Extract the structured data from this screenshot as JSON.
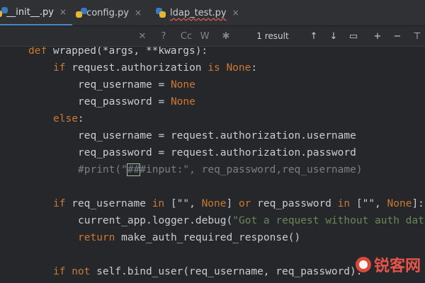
{
  "tabs": [
    {
      "label": "__init__.py",
      "active": true
    },
    {
      "label": "config.py",
      "active": false
    },
    {
      "label": "ldap_test.py",
      "active": false,
      "error": true
    }
  ],
  "tab_close_glyph": "×",
  "findbar": {
    "icons": [
      "close-icon",
      "regex-icon",
      "case-icon",
      "word-icon",
      "filter-icon"
    ],
    "labels": {
      "case": "Cc",
      "word": "W",
      "regex": "?"
    },
    "result_text": "1 result",
    "nav": [
      "up-arrow-icon",
      "down-arrow-icon",
      "select-all-icon",
      "add-selection-icon",
      "remove-selection-icon",
      "filter-icon"
    ]
  },
  "code": {
    "lines": [
      {
        "indent": 0,
        "tokens": [
          {
            "t": "kw",
            "v": "def "
          },
          {
            "t": "plain",
            "v": "wrapped(*args, **kwargs):"
          }
        ]
      },
      {
        "indent": 1,
        "tokens": [
          {
            "t": "kw",
            "v": "if "
          },
          {
            "t": "plain",
            "v": "request.authorization "
          },
          {
            "t": "kw",
            "v": "is None"
          },
          {
            "t": "plain",
            "v": ":"
          }
        ]
      },
      {
        "indent": 2,
        "tokens": [
          {
            "t": "plain",
            "v": "req_username = "
          },
          {
            "t": "kw",
            "v": "None"
          }
        ]
      },
      {
        "indent": 2,
        "tokens": [
          {
            "t": "plain",
            "v": "req_password = "
          },
          {
            "t": "kw",
            "v": "None"
          }
        ]
      },
      {
        "indent": 1,
        "tokens": [
          {
            "t": "kw",
            "v": "else"
          },
          {
            "t": "plain",
            "v": ":"
          }
        ]
      },
      {
        "indent": 2,
        "tokens": [
          {
            "t": "plain",
            "v": "req_username = request.authorization.username"
          }
        ]
      },
      {
        "indent": 2,
        "tokens": [
          {
            "t": "plain",
            "v": "req_password = request.authorization.password"
          }
        ]
      },
      {
        "indent": 2,
        "tokens": [
          {
            "t": "cm",
            "v": "#print(\""
          },
          {
            "t": "caret",
            "v": "##"
          },
          {
            "t": "cm",
            "v": "#input:\", req_password,req_username)"
          }
        ]
      },
      {
        "indent": 0,
        "tokens": []
      },
      {
        "indent": 1,
        "tokens": [
          {
            "t": "kw",
            "v": "if "
          },
          {
            "t": "plain",
            "v": "req_username "
          },
          {
            "t": "kw",
            "v": "in "
          },
          {
            "t": "plain",
            "v": "[\"\", "
          },
          {
            "t": "kw",
            "v": "None"
          },
          {
            "t": "plain",
            "v": "] "
          },
          {
            "t": "kw",
            "v": "or "
          },
          {
            "t": "plain",
            "v": "req_password "
          },
          {
            "t": "kw",
            "v": "in "
          },
          {
            "t": "plain",
            "v": "[\"\", "
          },
          {
            "t": "kw",
            "v": "None"
          },
          {
            "t": "plain",
            "v": "]:"
          }
        ]
      },
      {
        "indent": 2,
        "tokens": [
          {
            "t": "plain",
            "v": "current_app.logger.debug("
          },
          {
            "t": "str",
            "v": "\"Got a request without auth data"
          }
        ]
      },
      {
        "indent": 2,
        "tokens": [
          {
            "t": "kw",
            "v": "return "
          },
          {
            "t": "plain",
            "v": "make_auth_required_response()"
          }
        ]
      },
      {
        "indent": 0,
        "tokens": []
      },
      {
        "indent": 1,
        "tokens": [
          {
            "t": "kw",
            "v": "if not "
          },
          {
            "t": "plain",
            "v": "self.bind_user(req_username, req_password):"
          }
        ]
      }
    ]
  },
  "watermark": {
    "text": "锐客网"
  },
  "colors": {
    "keyword": "#cc7832",
    "comment": "#7a7e85",
    "string": "#6a8759",
    "accent": "#4a88c7"
  }
}
